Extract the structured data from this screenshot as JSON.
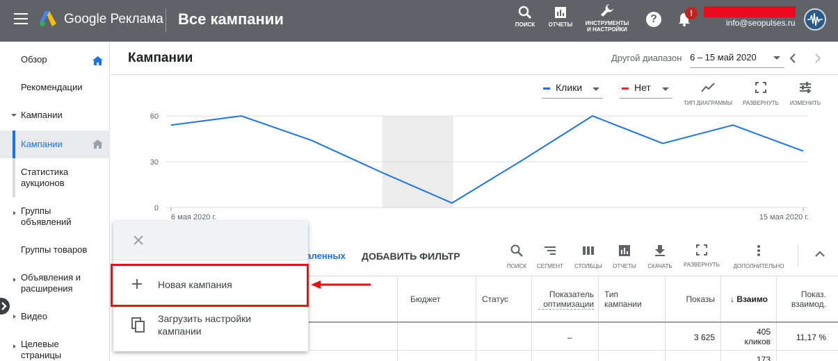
{
  "topbar": {
    "brand": "Google Реклама",
    "page_heading": "Все кампании",
    "tools": [
      {
        "label": "ПОИСК"
      },
      {
        "label": "ОТЧЕТЫ"
      },
      {
        "label_line1": "ИНСТРУМЕНТЫ",
        "label_line2": "И НАСТРОЙКИ"
      }
    ],
    "help_glyph": "?",
    "alert_badge": "!",
    "email": "info@seopulses.ru"
  },
  "sidebar": {
    "items": [
      {
        "label": "Обзор"
      },
      {
        "label": "Рекомендации"
      },
      {
        "label": "Кампании"
      },
      {
        "label": "Кампании"
      },
      {
        "label_line1": "Статистика",
        "label_line2": "аукционов"
      },
      {
        "label_line1": "Группы",
        "label_line2": "объявлений"
      },
      {
        "label": "Группы товаров"
      },
      {
        "label_line1": "Объявления и",
        "label_line2": "расширения"
      },
      {
        "label": "Видео"
      },
      {
        "label_line1": "Целевые",
        "label_line2": "страницы"
      }
    ]
  },
  "header": {
    "title": "Кампании",
    "range_label": "Другой диапазон",
    "range_value": "6 – 15 май 2020"
  },
  "chart_toolbar": {
    "metric1": "Клики",
    "metric1_color": "#1a73e8",
    "metric2": "Нет",
    "metric2_color": "#d93025",
    "chart_type": "ТИП ДИАГРАММЫ",
    "expand": "РАЗВЕРНУТЬ",
    "edit": "ИЗМЕНИТЬ"
  },
  "chart_data": {
    "type": "line",
    "series": [
      {
        "name": "Клики",
        "values": [
          54,
          60,
          44,
          23,
          3,
          31,
          60,
          42,
          54,
          37
        ]
      }
    ],
    "x_start_label": "6 мая 2020 г.",
    "x_end_label": "15 мая 2020 г.",
    "y_ticks": [
      "0",
      "30",
      "60"
    ],
    "ylim": [
      0,
      60
    ],
    "grid": true,
    "line_color": "#1a73e8",
    "highlight_band_between_points": [
      3,
      4
    ]
  },
  "table_toolbar": {
    "filter_link": "даленных",
    "add_filter": "ДОБАВИТЬ ФИЛЬТР",
    "tools": [
      {
        "label": "ПОИСК"
      },
      {
        "label": "СЕГМЕНТ"
      },
      {
        "label": "СТОЛБЦЫ"
      },
      {
        "label": "ОТЧЕТЫ"
      },
      {
        "label": "СКАЧАТЬ"
      },
      {
        "label": "РАЗВЕРНУТЬ"
      },
      {
        "label": "ДОПОЛНИТЕЛЬНО"
      }
    ]
  },
  "table": {
    "headers": {
      "budget": "Бюджет",
      "status": "Статус",
      "score_line1": "Показатель",
      "score_line2": "оптимизации",
      "type_line1": "Тип",
      "type_line2": "кампании",
      "impressions": "Показы",
      "interactions": "↓ Взаимо",
      "rate_line1": "Показ.",
      "rate_line2": "взаимод."
    },
    "total_row": {
      "score": "–",
      "impressions": "3 625",
      "interactions_line1": "405",
      "interactions_line2": "кликов",
      "rate": "11,17 %"
    },
    "next_row": {
      "interactions": "173"
    }
  },
  "popup": {
    "items": [
      {
        "label": "Новая кампания"
      },
      {
        "label_line1": "Загрузить настройки",
        "label_line2": "кампании"
      }
    ]
  }
}
